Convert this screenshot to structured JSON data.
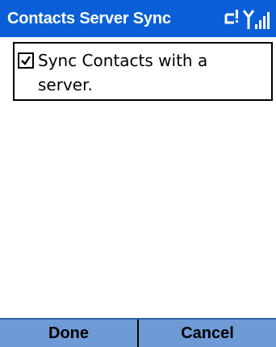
{
  "titlebar": {
    "title": "Contacts Server Sync",
    "status_icons": [
      "data-connection-icon",
      "signal-strength-icon"
    ],
    "color": "#0a5fd8"
  },
  "options": {
    "sync_contacts": {
      "checked": true,
      "label_line1": "Sync Contacts with a",
      "label_line2": "server."
    }
  },
  "softkeys": {
    "left_label": "Done",
    "right_label": "Cancel",
    "color": "#6e9bd6"
  }
}
